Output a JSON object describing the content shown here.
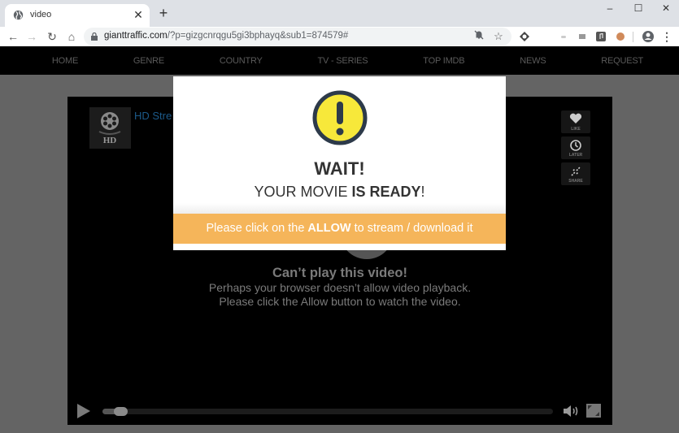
{
  "browser": {
    "tab": {
      "title": "video",
      "icon": "globe-icon"
    },
    "new_tab_label": "+",
    "window_controls": {
      "minimize": "–",
      "maximize": "☐",
      "close": "✕"
    },
    "url": {
      "domain": "gianttraffic.com",
      "path": "/?p=gizgcnrqgu5gi3bphayq&sub1=874579#"
    }
  },
  "site_nav": {
    "items": [
      "HOME",
      "GENRE",
      "COUNTRY",
      "TV - SERIES",
      "TOP IMDB",
      "NEWS",
      "REQUEST"
    ]
  },
  "player": {
    "logo_label": "HD",
    "title": "HD Stre",
    "side_buttons": [
      {
        "label": "LIKE",
        "icon": "heart-icon"
      },
      {
        "label": "LATER",
        "icon": "clock-icon"
      },
      {
        "label": "SHARE",
        "icon": "share-icon"
      }
    ],
    "error_title": "Can’t play this video!",
    "error_message": "Perhaps your browser doesn’t allow video playback. Please click the Allow button to watch the video.",
    "progress_percent": 4
  },
  "popup": {
    "icon": "warning-icon",
    "title": "WAIT!",
    "subtitle_normal": "YOUR MOVIE ",
    "subtitle_bold": "IS READY",
    "subtitle_end": "!",
    "allow_prefix": "Please click on the ",
    "allow_bold": "ALLOW",
    "allow_suffix": " to stream / download it",
    "colors": {
      "allow_bar": "#f5b55a",
      "warning_fill": "#f7e83a",
      "warning_stroke": "#2d3a4a"
    }
  }
}
